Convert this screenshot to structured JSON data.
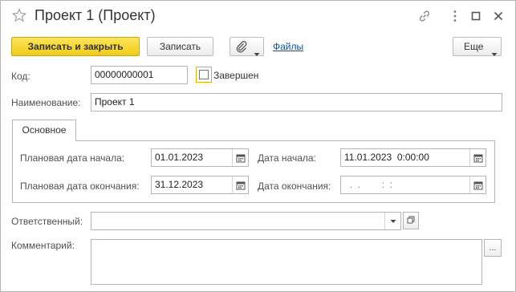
{
  "window": {
    "title": "Проект 1 (Проект)",
    "icons": [
      "star-icon",
      "link-icon",
      "more-icon",
      "maximize-icon",
      "close-icon"
    ]
  },
  "toolbar": {
    "save_close_label": "Записать и закрыть",
    "save_label": "Записать",
    "attach_icon": "paperclip-icon",
    "files_label": "Файлы",
    "more_label": "Еще"
  },
  "form": {
    "code_label": "Код:",
    "code_value": "00000000001",
    "completed_label": "Завершен",
    "completed_checked": false,
    "name_label": "Наименование:",
    "name_value": "Проект 1",
    "responsible_label": "Ответственный:",
    "responsible_value": "",
    "comment_label": "Комментарий:",
    "comment_button": "..."
  },
  "tabs": [
    {
      "label": "Основное",
      "active": true
    }
  ],
  "main_tab": {
    "plan_start_label": "Плановая дата начала:",
    "plan_start_value": "01.01.2023",
    "plan_end_label": "Плановая дата окончания:",
    "plan_end_value": "31.12.2023",
    "start_label": "Дата начала:",
    "start_value": "11.01.2023  0:00:00",
    "end_label": "Дата окончания:",
    "end_value": "  .  .        :  :"
  },
  "colors": {
    "primary_button": "#f2cb18",
    "link": "#0b4f9c",
    "border": "#b5b5b5",
    "checkbox_focus": "#e3b300"
  }
}
